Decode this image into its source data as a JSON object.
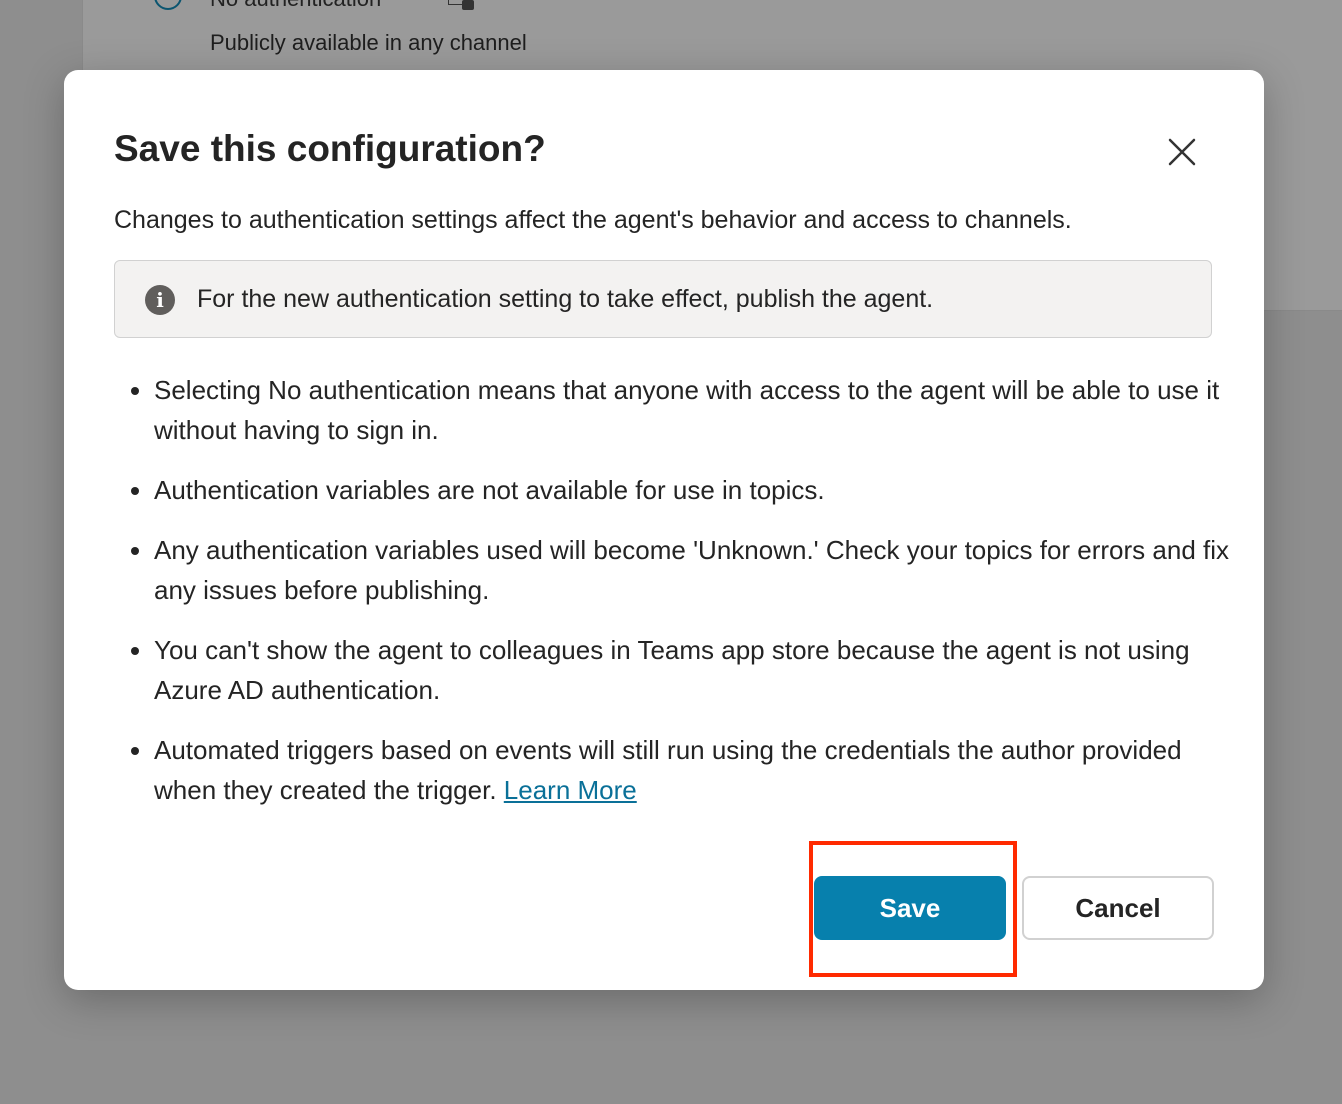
{
  "background": {
    "option_title": "No authentication",
    "option_description": "Publicly available in any channel"
  },
  "dialog": {
    "title": "Save this configuration?",
    "description": "Changes to authentication settings affect the agent's behavior and access to channels.",
    "info_message": "For the new authentication setting to take effect, publish the agent.",
    "bullets": [
      "Selecting No authentication means that anyone with access to the agent will be able to use it without having to sign in.",
      "Authentication variables are not available for use in topics.",
      "Any authentication variables used will become 'Unknown.' Check your topics for errors and fix any issues before publishing.",
      "You can't show the agent to colleagues in Teams app store because the agent is not using Azure AD authentication.",
      "Automated triggers based on events will still run using the credentials the author provided when they created the trigger."
    ],
    "learn_more": "Learn More",
    "save_label": "Save",
    "cancel_label": "Cancel"
  },
  "colors": {
    "primary": "#0780ad",
    "highlight": "#ff2a00",
    "link": "#0a7098"
  },
  "icons": {
    "close": "close-icon",
    "info": "info-icon",
    "lock": "lock-icon"
  }
}
